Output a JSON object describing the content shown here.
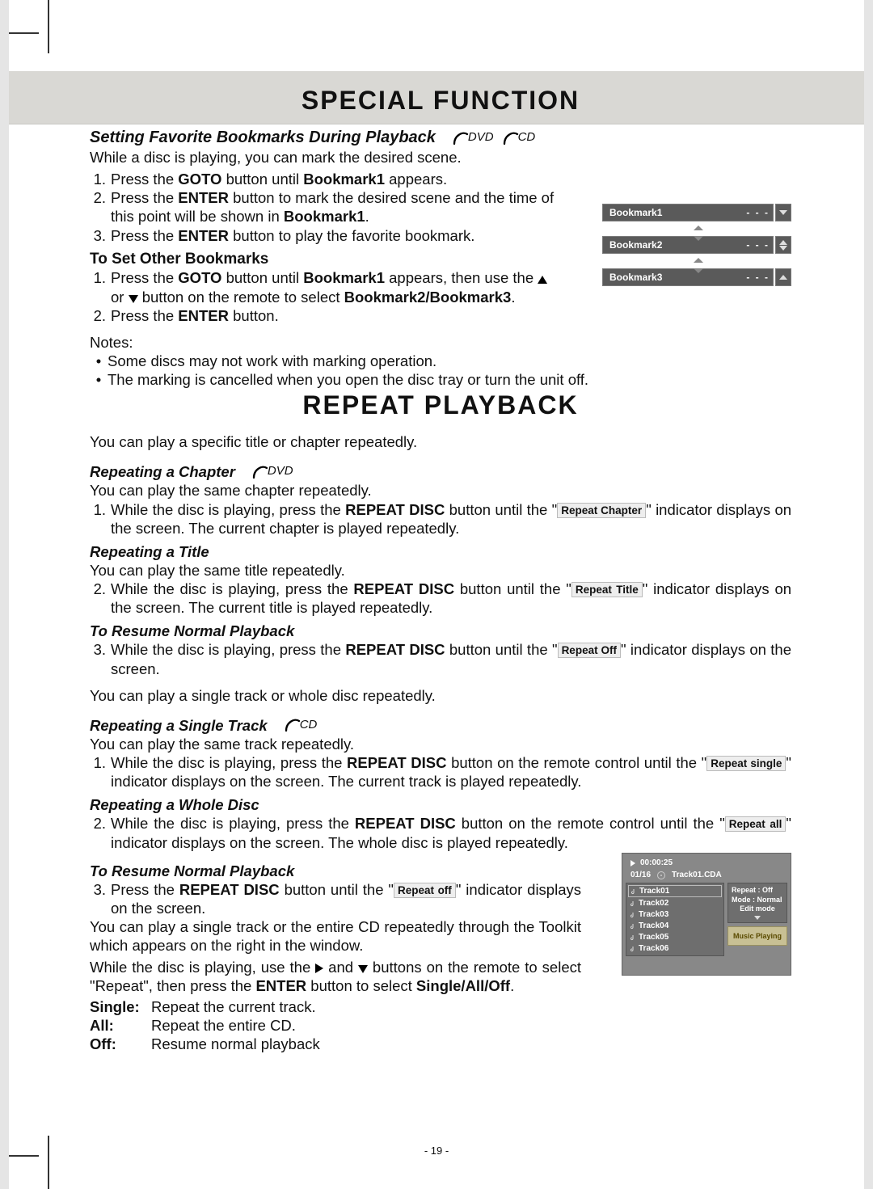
{
  "headings": {
    "special_function": "SPECIAL  FUNCTION",
    "bookmarks_title": "Setting Favorite Bookmarks During Playback",
    "to_set_other": "To Set Other Bookmarks",
    "notes": "Notes:",
    "repeat_playback": "REPEAT  PLAYBACK",
    "repeating_chapter": "Repeating a Chapter",
    "repeating_title": "Repeating a Title",
    "resume_normal": "To Resume Normal Playback",
    "repeating_single_track": "Repeating a Single Track",
    "repeating_whole_disc": "Repeating a Whole Disc",
    "resume_normal2": "To Resume Normal Playback"
  },
  "disc_labels": {
    "dvd": "DVD",
    "cd": "CD"
  },
  "bookmarks": {
    "intro": "While a disc is playing, you can mark the desired scene.",
    "steps": {
      "s1a": "Press the ",
      "s1b": "GOTO",
      "s1c": " button until ",
      "s1d": "Bookmark1",
      "s1e": " appears.",
      "s2a": "Press the ",
      "s2b": "ENTER",
      "s2c": " button to mark the desired scene and the time of this point will be shown in ",
      "s2d": "Bookmark1",
      "s2e": ".",
      "s3a": "Press the ",
      "s3b": "ENTER",
      "s3c": " button to play the favorite bookmark."
    },
    "other": {
      "o1a": "Press the ",
      "o1b": "GOTO",
      "o1c": " button until ",
      "o1d": "Bookmark1",
      "o1e": " appears, then use the ",
      "o1f": " or ",
      "o1g": " button on the remote to select ",
      "o1h": "Bookmark2/Bookmark3",
      "o1i": ".",
      "o2a": "Press the ",
      "o2b": "ENTER",
      "o2c": " button."
    },
    "notes": {
      "n1": "Some discs may not work with marking operation.",
      "n2": "The marking is cancelled when you open the disc tray or turn the unit off."
    },
    "osd": {
      "rows": [
        "Bookmark1",
        "Bookmark2",
        "Bookmark3"
      ],
      "value": "- - -"
    }
  },
  "repeat": {
    "intro": "You can play a specific title or chapter repeatedly.",
    "chapter_intro": "You can play the same chapter repeatedly.",
    "chapter_step_a": "While the disc is playing, press the ",
    "chapter_step_b": "REPEAT DISC",
    "chapter_step_c": " button until the \"",
    "chapter_step_d": "\" indicator displays on the screen. The current chapter is played repeatedly.",
    "indicator_chapter": "Repeat  Chapter",
    "title_intro": "You can play the same title repeatedly.",
    "title_step_a": "While the disc is playing, press the ",
    "title_step_b": "REPEAT DISC",
    "title_step_c": " button until the \"",
    "title_step_d": "\" indicator displays on the screen. The current title is played repeatedly.",
    "indicator_title": "Repeat  Title",
    "resume_step_a": "While the disc is playing, press the ",
    "resume_step_b": "REPEAT DISC",
    "resume_step_c": " button until the \"",
    "resume_step_d": "\" indicator displays on the screen.",
    "indicator_off": "Repeat  Off",
    "single_intro_line": "You can play a single track or whole disc repeatedly.",
    "track_intro": "You can play the same track repeatedly.",
    "track_step_a": "While the disc is playing, press the ",
    "track_step_b": "REPEAT DISC",
    "track_step_c": " button on the remote control until the \"",
    "track_step_d": "\" indicator displays on the screen. The current track is played repeatedly.",
    "indicator_single": "Repeat  single",
    "whole_step_a": "While the disc is playing, press the ",
    "whole_step_b": "REPEAT DISC",
    "whole_step_c": " button on the remote control until the \"",
    "whole_step_d": "\" indicator displays on the screen. The whole disc is played repeatedly.",
    "indicator_all": "Repeat  all",
    "resume2_a": "Press the ",
    "resume2_b": "REPEAT DISC",
    "resume2_c": " button until the \"",
    "resume2_d": "\" indicator displays on the screen.",
    "indicator_off2": "Repeat  off",
    "toolkit_a": "You can play a single track or the entire CD repeatedly through the Toolkit which appears on the right in the window.",
    "toolkit_b1": "While the disc is playing, use the ",
    "toolkit_b2": " and ",
    "toolkit_b3": " buttons on the remote to select \"Repeat\", then press the ",
    "toolkit_b4": "ENTER",
    "toolkit_b5": " button to select ",
    "toolkit_b6": "Single/All/Off",
    "toolkit_b7": ".",
    "defs": {
      "single_l": "Single:",
      "single_v": "Repeat the current track.",
      "all_l": "All:",
      "all_v": "Repeat the entire CD.",
      "off_l": "Off:",
      "off_v": "Resume normal playback"
    }
  },
  "toolkit_osd": {
    "time": "00:00:25",
    "counter": "01/16",
    "file": "Track01.CDA",
    "tracks": [
      "Track01",
      "Track02",
      "Track03",
      "Track04",
      "Track05",
      "Track06"
    ],
    "info": {
      "repeat": "Repeat : Off",
      "mode": "Mode    : Normal",
      "edit": "Edit mode"
    },
    "status": "Music Playing"
  },
  "page_number": "- 19 -"
}
